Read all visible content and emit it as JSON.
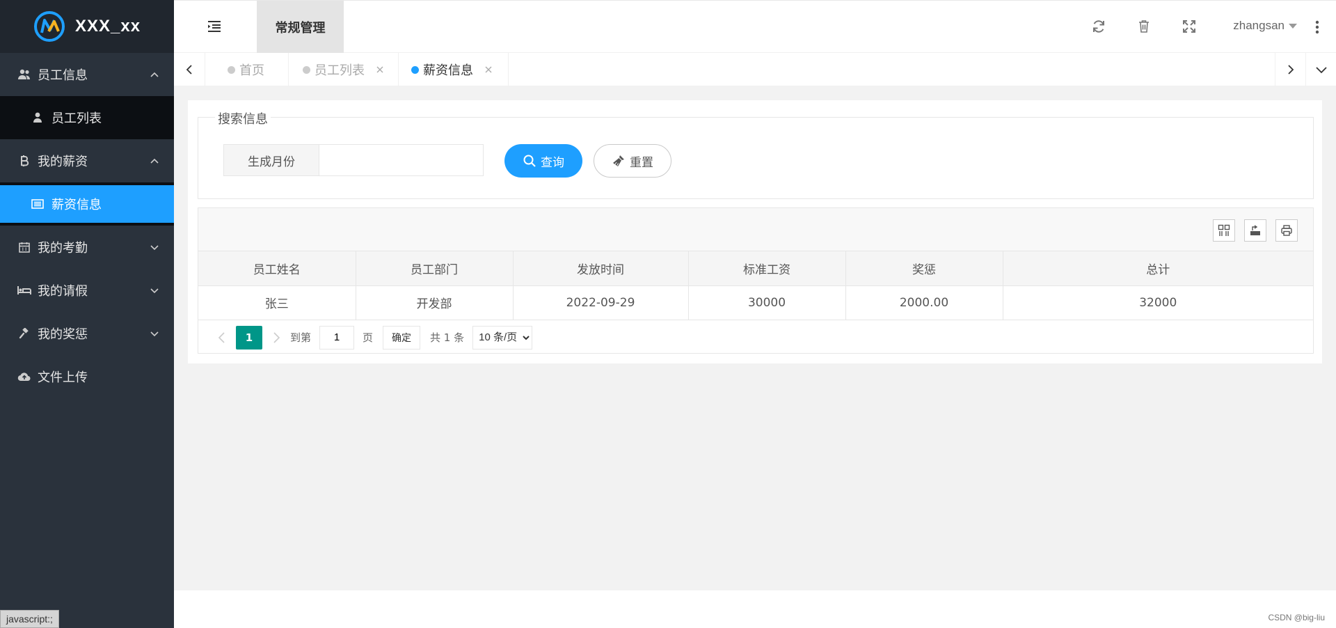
{
  "app": {
    "title": "XXX_xx"
  },
  "sidebar": {
    "items": [
      {
        "label": "员工信息",
        "icon": "users-icon",
        "expanded": true
      },
      {
        "label": "员工列表",
        "icon": "user-icon",
        "sub": true
      },
      {
        "label": "我的薪资",
        "icon": "bitcoin-icon",
        "expanded": true
      },
      {
        "label": "薪资信息",
        "icon": "list-icon",
        "sub": true,
        "active": true
      },
      {
        "label": "我的考勤",
        "icon": "calendar-icon",
        "expanded": false
      },
      {
        "label": "我的请假",
        "icon": "bed-icon",
        "expanded": false
      },
      {
        "label": "我的奖惩",
        "icon": "gavel-icon",
        "expanded": false
      },
      {
        "label": "文件上传",
        "icon": "cloud-upload-icon"
      }
    ],
    "status_tip": "javascript:;"
  },
  "header": {
    "module_tab": "常规管理",
    "username": "zhangsan"
  },
  "tabs": [
    {
      "label": "首页"
    },
    {
      "label": "员工列表"
    },
    {
      "label": "薪资信息",
      "active": true
    }
  ],
  "search": {
    "legend": "搜索信息",
    "month_label": "生成月份",
    "month_value": "",
    "query_label": "查询",
    "reset_label": "重置"
  },
  "table": {
    "columns": [
      "员工姓名",
      "员工部门",
      "发放时间",
      "标准工资",
      "奖惩",
      "总计"
    ],
    "rows": [
      [
        "张三",
        "开发部",
        "2022-09-29",
        "30000",
        "2000.00",
        "32000"
      ]
    ]
  },
  "pager": {
    "current": "1",
    "goto_prefix": "到第",
    "goto_value": "1",
    "goto_suffix": "页",
    "confirm": "确定",
    "total": "共 1 条",
    "page_size": "10 条/页"
  },
  "footer": {
    "credit": "CSDN @big-liu"
  },
  "colors": {
    "accent": "#1e9fff",
    "sidebar_bg": "#2a323c",
    "pager_active": "#009688"
  }
}
